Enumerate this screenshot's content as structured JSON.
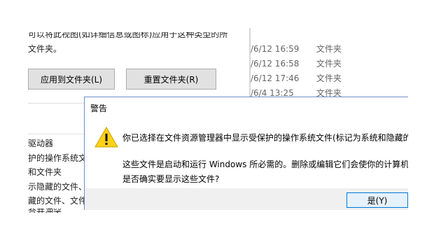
{
  "folder_options": {
    "intro_line1": "可以将此视图(如详细信息或图标)应用于这种类型的所",
    "intro_line2": "文件夹。",
    "apply_button": "应用到文件夹(L)",
    "reset_button": "重置文件夹(R)",
    "tree_items": [
      "驱动器",
      "护的操作系统文",
      "和文件夹",
      "示隐藏的文件、文",
      "藏的文件、文件",
      "合并冲突"
    ]
  },
  "file_list": {
    "rows": [
      {
        "date": "/6/12 16:59",
        "type": "文件夹"
      },
      {
        "date": "/6/12 16:58",
        "type": "文件夹"
      },
      {
        "date": "/6/12 17:46",
        "type": "文件夹"
      },
      {
        "date": "/6/4 13:25",
        "type": "文件夹"
      }
    ]
  },
  "warning_dialog": {
    "title": "警告",
    "icon": "warning-icon",
    "message_line1": "你已选择在文件资源管理器中显示受保护的操作系统文件(标记为系统和隐藏的文",
    "message_line2": "这些文件是启动和运行 Windows 所必需的。删除或编辑它们会使你的计算机无",
    "message_line3": "是否确实要显示这些文件?",
    "yes_button": "是(Y)",
    "accent_color": "#0078d7",
    "icon_color": "#fcd116"
  }
}
